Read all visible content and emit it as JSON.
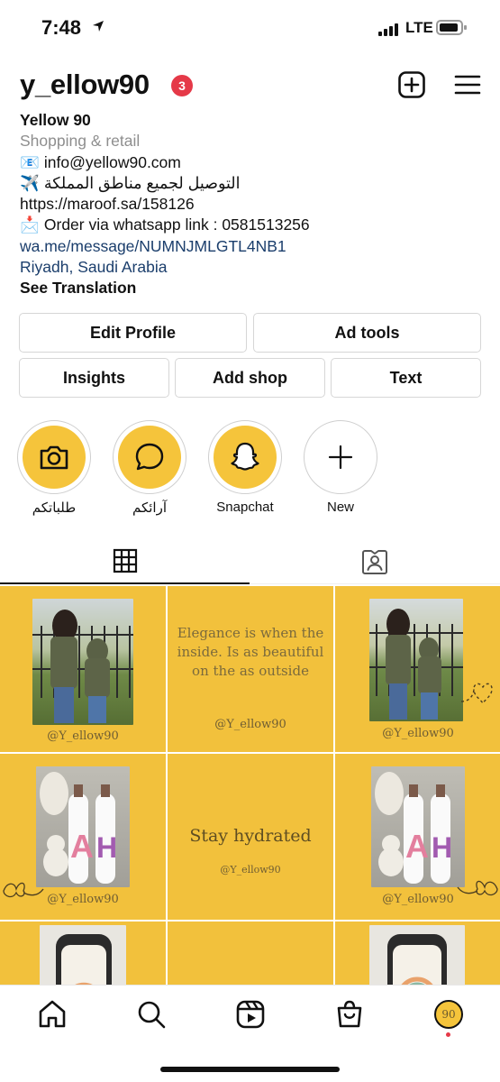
{
  "status_bar": {
    "time": "7:48",
    "network": "LTE"
  },
  "header": {
    "username": "y_ellow90",
    "notification_count": "3"
  },
  "bio": {
    "name": "Yellow 90",
    "category": "Shopping & retail",
    "email_emoji": "📧",
    "email": "info@yellow90.com",
    "delivery_emoji": "✈️",
    "delivery": "التوصيل لجميع مناطق المملكة",
    "maroof_url": "https://maroof.sa/158126",
    "order_emoji": "📩",
    "order": "Order via whatsapp link : 0581513256",
    "whatsapp_link": "wa.me/message/NUMNJMLGTL4NB1",
    "location": "Riyadh, Saudi Arabia",
    "see_translation": "See Translation"
  },
  "actions": {
    "edit_profile": "Edit Profile",
    "ad_tools": "Ad tools",
    "insights": "Insights",
    "add_shop": "Add shop",
    "text": "Text"
  },
  "highlights": [
    {
      "label": "طلباتكم",
      "icon": "camera-icon"
    },
    {
      "label": "آرائكم",
      "icon": "speech-bubble-icon"
    },
    {
      "label": "Snapchat",
      "icon": "snapchat-ghost-icon"
    },
    {
      "label": "New",
      "icon": "plus-icon"
    }
  ],
  "tabs": [
    {
      "name": "grid",
      "icon": "grid-icon",
      "active": true
    },
    {
      "name": "tagged",
      "icon": "tagged-person-icon",
      "active": false
    }
  ],
  "posts": {
    "handle": "@Y_ellow90",
    "quote_1": "Elegance is when the inside. Is as beautiful on the as outside",
    "quote_2": "Stay hydrated",
    "bottle_letter_1": "A",
    "bottle_letter_2": "H"
  },
  "bottom_nav": {
    "items": [
      "home-icon",
      "search-icon",
      "reels-icon",
      "shop-bag-icon",
      "profile-avatar"
    ],
    "avatar_text": "90"
  },
  "colors": {
    "accent_yellow": "#f2c13c",
    "badge_red": "#e53948",
    "link_blue": "#1b3e6c"
  }
}
